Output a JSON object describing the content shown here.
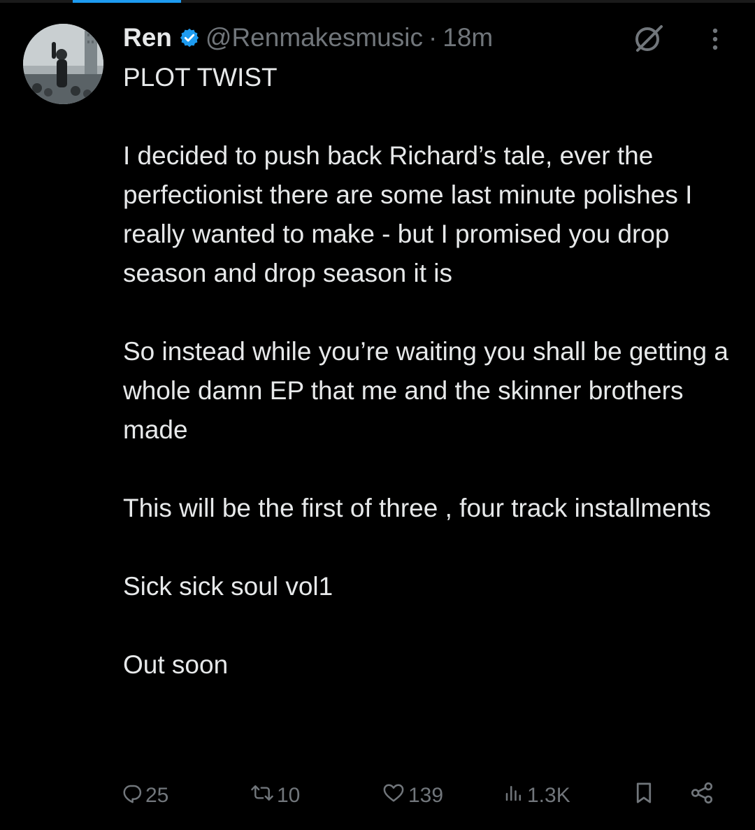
{
  "author": {
    "name": "Ren",
    "handle": "@Renmakesmusic",
    "time": "18m",
    "separator": "·"
  },
  "tweet": {
    "paragraphs": [
      "PLOT TWIST",
      "I decided to push back Richard’s tale, ever the perfectionist there are some last minute polishes I really wanted to make - but I promised you drop season and drop season it is",
      "So instead while you’re waiting you shall be getting a whole damn EP that me and the skinner brothers made",
      "This will be the first of three , four track installments",
      "Sick sick soul vol1",
      "Out soon"
    ]
  },
  "actions": {
    "reply_count": "25",
    "repost_count": "10",
    "like_count": "139",
    "view_count": "1.3K"
  },
  "icons": {
    "verified": "verified-badge-icon",
    "grok": "grok-icon",
    "more": "more-vertical-icon",
    "reply": "reply-icon",
    "repost": "repost-icon",
    "like": "heart-icon",
    "views": "views-chart-icon",
    "bookmark": "bookmark-icon",
    "share": "share-icon"
  },
  "colors": {
    "background": "#000000",
    "text": "#e7e9ea",
    "muted": "#71767b",
    "accent": "#1d9bf0"
  }
}
